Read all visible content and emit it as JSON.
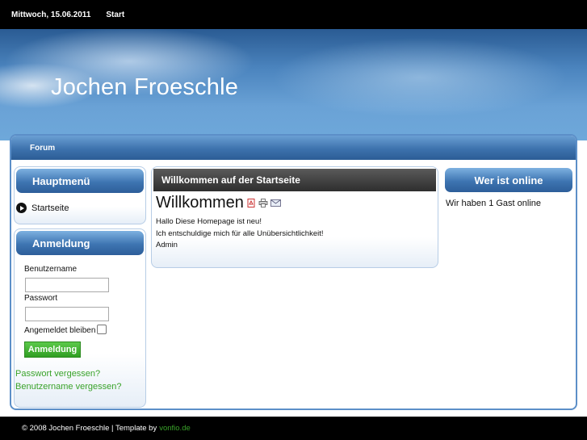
{
  "topbar": {
    "date": "Mittwoch, 15.06.2011",
    "start_link": "Start"
  },
  "header": {
    "site_title": "Jochen Froeschle"
  },
  "navbar": {
    "items": [
      "Forum"
    ]
  },
  "main_menu": {
    "title": "Hauptmenü",
    "items": [
      {
        "label": "Startseite",
        "icon": "play-bullet-icon"
      }
    ]
  },
  "login": {
    "title": "Anmeldung",
    "username_label": "Benutzername",
    "username_value": "",
    "password_label": "Passwort",
    "password_value": "",
    "remember_label": "Angemeldet bleiben",
    "remember_checked": false,
    "submit_label": "Anmeldung",
    "forgot_password": "Passwort vergessen?",
    "forgot_username": "Benutzername vergessen?"
  },
  "content": {
    "section_title": "Willkommen auf der Startseite",
    "article_title": "Willkommen",
    "icons": [
      "pdf-icon",
      "print-icon",
      "email-icon"
    ],
    "lines": [
      "Hallo Diese Homepage ist neu!",
      "Ich entschuldige mich für alle Unübersichtlichkeit!",
      "Admin"
    ]
  },
  "who_online": {
    "title": "Wer ist online",
    "text": "Wir haben 1 Gast online"
  },
  "footer": {
    "copyright": "© 2008 Jochen Froeschle | Template by",
    "credit_link": "vonfio.de"
  },
  "colors": {
    "accent_blue": "#3e75b2",
    "link_green": "#3aa32a",
    "bar_black": "#000000"
  }
}
